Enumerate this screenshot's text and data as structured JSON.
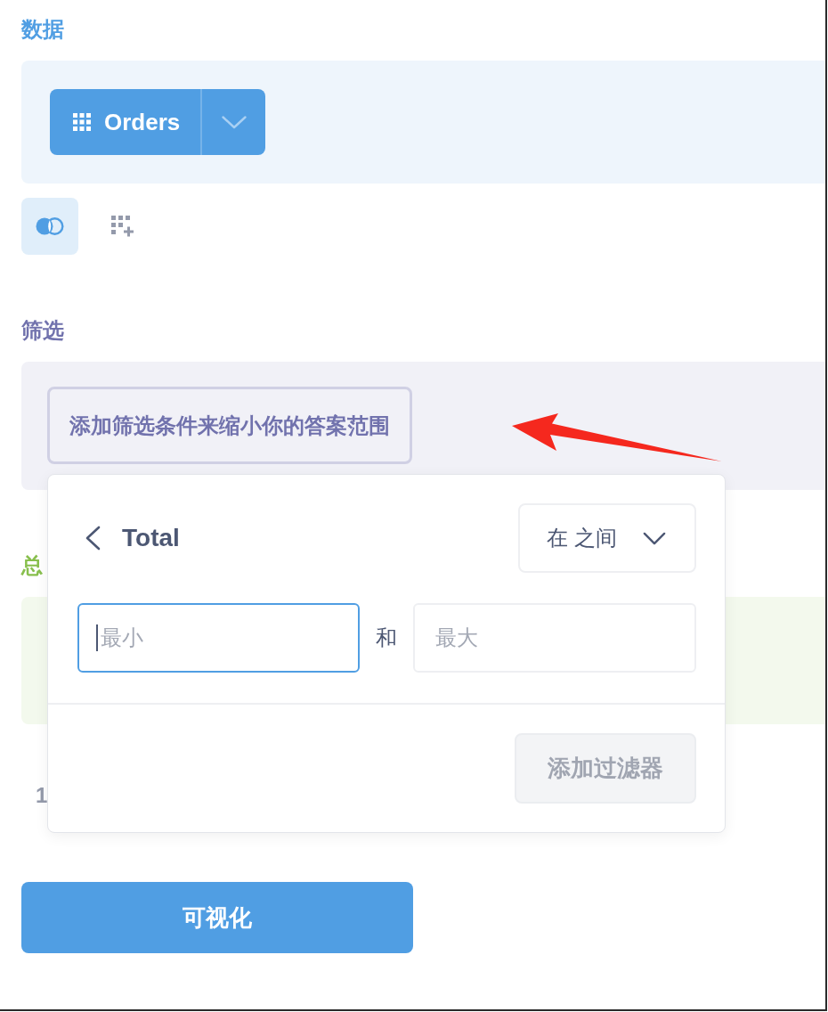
{
  "sections": [
    {
      "kind": "data",
      "label": "数据",
      "color": "#509ee3",
      "source": {
        "name": "Orders"
      },
      "tools": [
        {
          "kind": "join",
          "selected": true
        },
        {
          "kind": "expression",
          "selected": false
        }
      ]
    },
    {
      "kind": "filter",
      "label": "筛选",
      "color": "#7172ad",
      "prompt": "添加筛选条件来缩小你的答案范围"
    },
    {
      "kind": "summarize",
      "label": "总",
      "color": "#88bf4d"
    }
  ],
  "fragment": "1",
  "filter_popover": {
    "column": "Total",
    "operator": "在 之间",
    "min": {
      "placeholder": "最小",
      "focused": true
    },
    "joiner": "和",
    "max": {
      "placeholder": "最大",
      "focused": false
    },
    "submit": {
      "label": "添加过滤器",
      "disabled": true
    }
  },
  "visualize_button": {
    "label": "可视化"
  }
}
